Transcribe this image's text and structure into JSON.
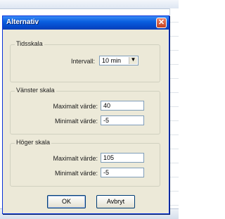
{
  "dialog": {
    "title": "Alternativ",
    "close_icon": "close-icon"
  },
  "time_scale": {
    "group_label": "Tidsskala",
    "interval_label": "Intervall:",
    "interval_value": "10 min",
    "dropdown_icon": "chevron-down-icon"
  },
  "left_scale": {
    "group_label": "Vänster skala",
    "max_label": "Maximalt värde:",
    "max_value": "40",
    "min_label": "Minimalt värde:",
    "min_value": "-5"
  },
  "right_scale": {
    "group_label": "Höger skala",
    "max_label": "Maximalt värde:",
    "max_value": "105",
    "min_label": "Minimalt värde:",
    "min_value": "-5"
  },
  "buttons": {
    "ok_label": "OK",
    "cancel_label": "Avbryt"
  },
  "colors": {
    "titlebar": "#0a5fe0",
    "dialog_bg": "#ece9d8",
    "close_button": "#c4401f"
  }
}
